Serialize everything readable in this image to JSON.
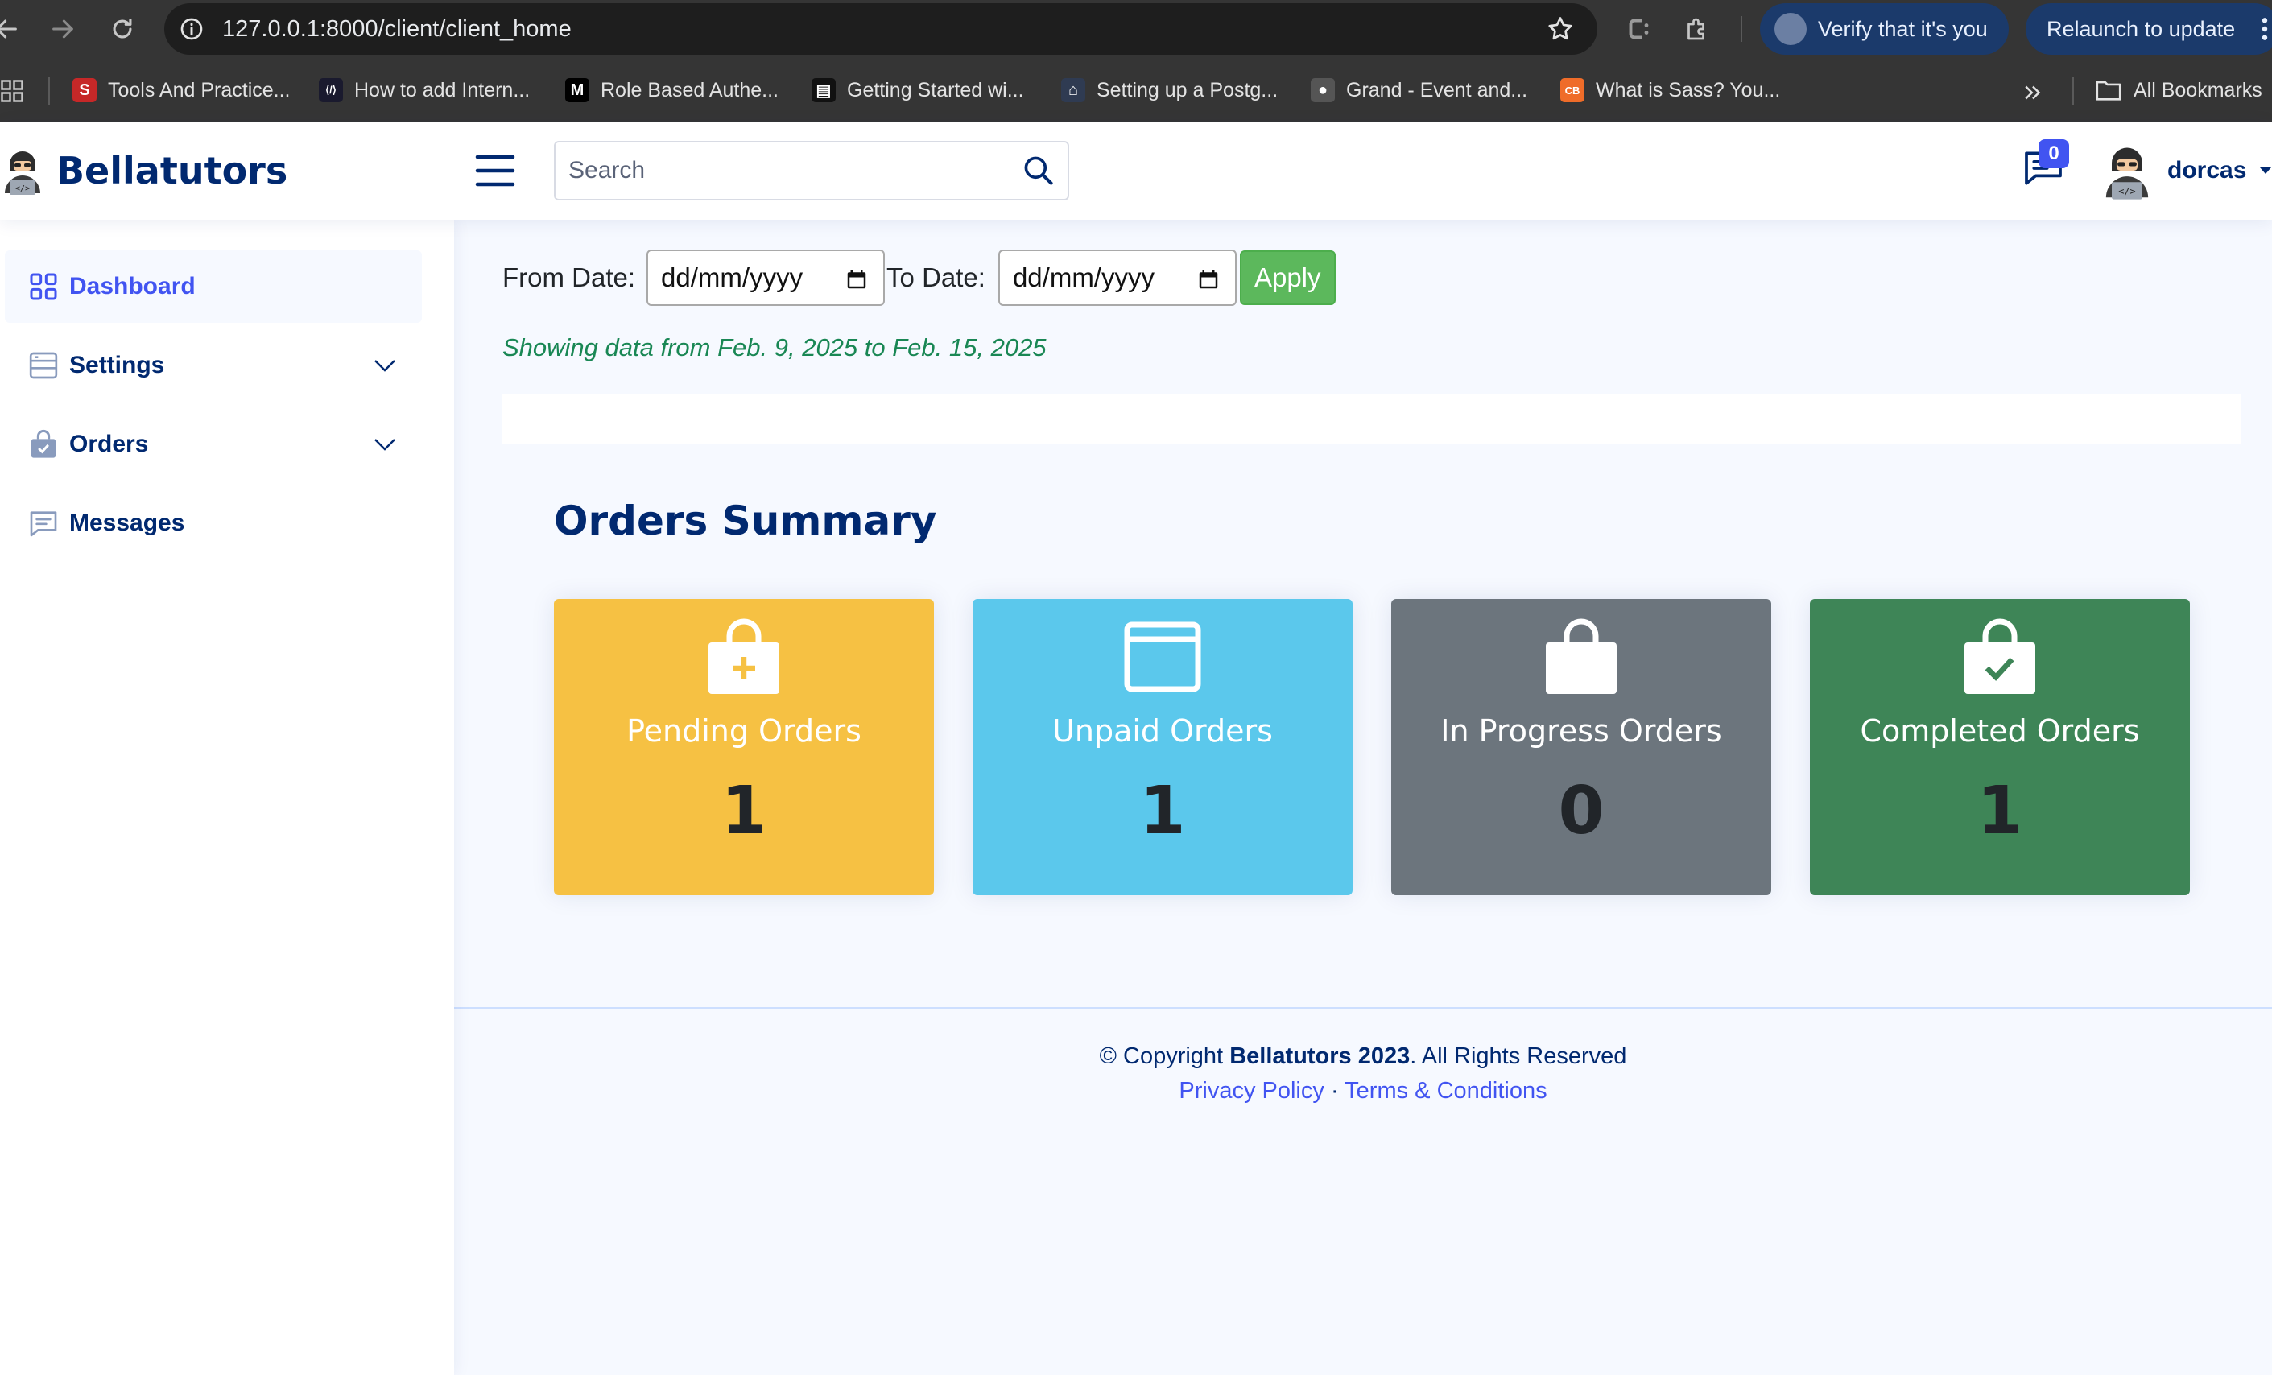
{
  "browser": {
    "url": "127.0.0.1:8000/client/client_home",
    "verify_label": "Verify that it's you",
    "relaunch_label": "Relaunch to update",
    "bookmarks": [
      {
        "label": "Tools And Practice...",
        "icon": "S",
        "color": "#c62828"
      },
      {
        "label": "How to add Intern...",
        "icon": "⟨/⟩",
        "color": "#1a1a2e"
      },
      {
        "label": "Role Based Authe...",
        "icon": "M",
        "color": "#000000"
      },
      {
        "label": "Getting Started wi...",
        "icon": "▤",
        "color": "#111111"
      },
      {
        "label": "Setting up a Postg...",
        "icon": "⌂",
        "color": "#2f3b52"
      },
      {
        "label": "Grand - Event and...",
        "icon": "●",
        "color": "#555555"
      },
      {
        "label": "What is Sass? You...",
        "icon": "CB",
        "color": "#ef6c29"
      }
    ],
    "all_bookmarks_label": "All Bookmarks"
  },
  "header": {
    "brand": "Bellatutors",
    "search_placeholder": "Search",
    "message_count": "0",
    "username": "dorcas"
  },
  "sidebar": {
    "items": [
      {
        "label": "Dashboard",
        "icon": "grid-icon",
        "active": true
      },
      {
        "label": "Settings",
        "icon": "layout-icon",
        "expandable": true
      },
      {
        "label": "Orders",
        "icon": "bag-check-icon",
        "expandable": true
      },
      {
        "label": "Messages",
        "icon": "chat-icon"
      }
    ]
  },
  "filter": {
    "from_label": "From Date:",
    "from_value": "dd/mm/yyyy",
    "to_label": "To Date:",
    "to_value": "dd/mm/yyyy",
    "apply_label": "Apply",
    "showing_text": "Showing data from Feb. 9, 2025 to Feb. 15, 2025"
  },
  "summary": {
    "title": "Orders Summary",
    "cards": [
      {
        "title": "Pending Orders",
        "count": "1",
        "icon": "bag-plus-icon",
        "color": "#f6c143"
      },
      {
        "title": "Unpaid Orders",
        "count": "1",
        "icon": "window-icon",
        "color": "#5bc8ec"
      },
      {
        "title": "In Progress Orders",
        "count": "0",
        "icon": "bag-icon",
        "color": "#6c757d"
      },
      {
        "title": "Completed Orders",
        "count": "1",
        "icon": "bag-check-icon",
        "color": "#3e8557"
      }
    ]
  },
  "footer": {
    "copyright_prefix": "© Copyright",
    "copyright_brand": "Bellatutors 2023",
    "copyright_suffix": ". All Rights Reserved",
    "privacy_label": "Privacy Policy",
    "separator": "·",
    "terms_label": "Terms & Conditions"
  }
}
